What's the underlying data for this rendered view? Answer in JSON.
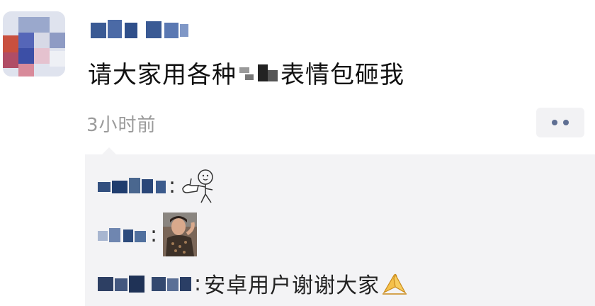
{
  "post": {
    "text_before": "请大家用各种",
    "text_after": "表情包砸我",
    "time": "3小时前"
  },
  "comments": [
    {
      "colon": ":"
    },
    {
      "colon": ":"
    },
    {
      "colon": ":",
      "text": "安卓用户谢谢大家"
    }
  ],
  "icons": {
    "more": "more-dots-icon",
    "sticker_thumbsup": "cartoon-thumbs-up-sticker",
    "photo_sticker": "person-photo-sticker",
    "praying_hands": "praying-hands-emoji"
  },
  "colors": {
    "comment_background": "#f3f3f5",
    "time_text": "#9a9a9a",
    "more_dots": "#5f6f93"
  }
}
